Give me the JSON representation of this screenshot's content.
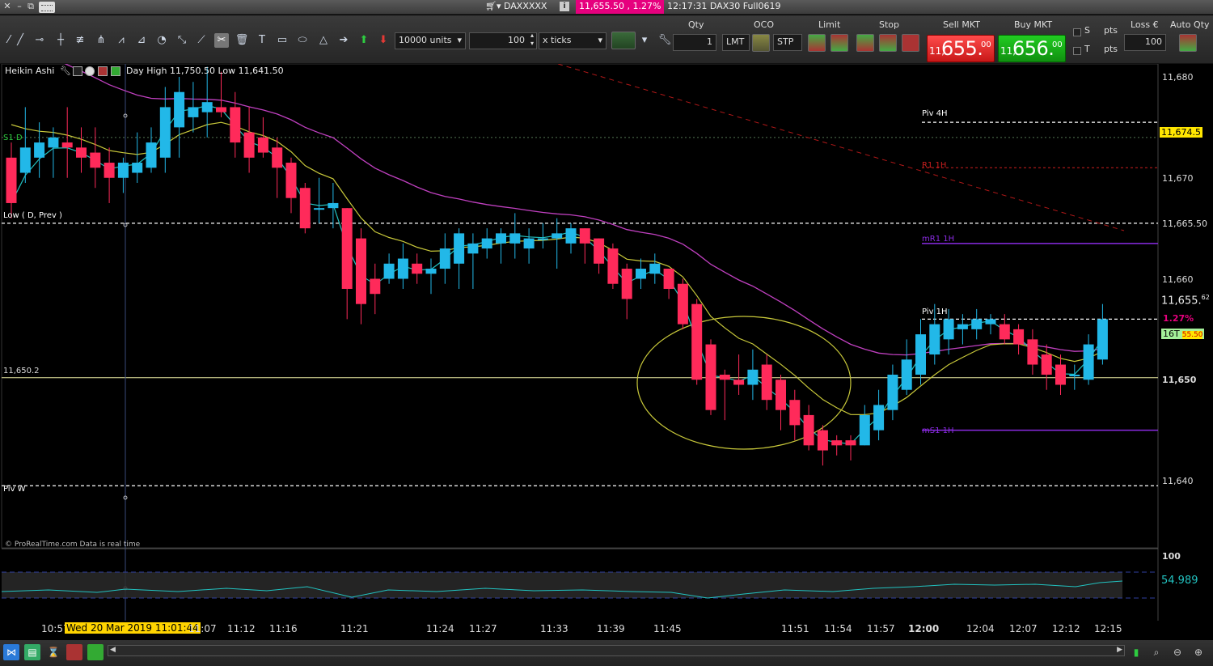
{
  "titlebar": {
    "instrument": "DAXXXXX",
    "price_change": "11,655.50 , 1.27%",
    "time_and_contract": "12:17:31 DAX30 Full0619"
  },
  "toolbar": {
    "units": "10000 units",
    "amount": "100",
    "mode": "x ticks",
    "qty_label": "Qty",
    "qty_value": "1",
    "oco_label": "OCO",
    "lmt": "LMT",
    "stp": "STP",
    "limit_label": "Limit",
    "stop_label": "Stop",
    "sell_label": "Sell MKT",
    "buy_label": "Buy MKT",
    "sell_price_small": "11,",
    "sell_price_big": "655.",
    "sell_price_sup": "00",
    "buy_price_small": "11,",
    "buy_price_big": "656.",
    "buy_price_sup": "00",
    "s_label": "S",
    "t_label": "T",
    "pts1": "pts",
    "pts2": "pts",
    "loss_label": "Loss €",
    "auto_qty_label": "Auto Qty",
    "loss_value": "100"
  },
  "chart": {
    "indicator_name": "Heikin Ashi",
    "day_hl": "Day High 11,750.50 Low 11,641.50",
    "y_labels": [
      "11,680",
      "11,670",
      "11,665.50",
      "11,660",
      "11,655",
      "11,650",
      "11,640"
    ],
    "price_tag_1": "11,674.5",
    "current_price": "11,655.",
    "current_sup": "62",
    "pct_tag": "1.27%",
    "timer_tag": "16T",
    "timer_price": "55.50",
    "level_line_value": "11,650.2",
    "labels": {
      "s1d": "S1 D",
      "low_d_prev": "Low ( D, Prev )",
      "piv_w": "Piv W",
      "piv_4h": "Piv 4H",
      "r1_1h": "R1 1H",
      "mr1_1h": "mR1 1H",
      "piv_1h": "Piv 1H",
      "ms1_1h": "mS1 1H"
    },
    "credit": "© ProRealTime.com  Data is real time",
    "osc_100": "100",
    "osc_value": "54.989"
  },
  "timeaxis": {
    "cursor_date": "Wed 20 Mar 2019 11:01:44",
    "ticks": [
      "10:57",
      "11:07",
      "11:12",
      "11:16",
      "11:21",
      "11:24",
      "11:27",
      "11:33",
      "11:39",
      "11:45",
      "11:51",
      "11:54",
      "11:57",
      "12:00",
      "12:04",
      "12:07",
      "12:12",
      "12:15"
    ]
  },
  "chart_data": {
    "type": "candlestick",
    "title": "",
    "ylim": [
      11637,
      11683
    ],
    "candles": [
      {
        "o": 11672.0,
        "h": 11673.5,
        "l": 11666.0,
        "c": 11667.5
      },
      {
        "o": 11670.5,
        "h": 11677.0,
        "l": 11669.5,
        "c": 11673.0
      },
      {
        "o": 11672.0,
        "h": 11675.5,
        "l": 11670.0,
        "c": 11673.5
      },
      {
        "o": 11673.0,
        "h": 11675.0,
        "l": 11670.0,
        "c": 11674.0
      },
      {
        "o": 11673.5,
        "h": 11677.0,
        "l": 11670.0,
        "c": 11673.0
      },
      {
        "o": 11673.0,
        "h": 11675.0,
        "l": 11670.5,
        "c": 11672.0
      },
      {
        "o": 11672.5,
        "h": 11675.0,
        "l": 11669.0,
        "c": 11671.0
      },
      {
        "o": 11671.5,
        "h": 11673.0,
        "l": 11667.5,
        "c": 11670.0
      },
      {
        "o": 11670.0,
        "h": 11672.0,
        "l": 11668.5,
        "c": 11671.5
      },
      {
        "o": 11670.5,
        "h": 11674.5,
        "l": 11669.5,
        "c": 11671.5
      },
      {
        "o": 11671.0,
        "h": 11675.0,
        "l": 11670.5,
        "c": 11673.5
      },
      {
        "o": 11672.0,
        "h": 11679.0,
        "l": 11670.5,
        "c": 11677.0
      },
      {
        "o": 11675.0,
        "h": 11680.0,
        "l": 11672.0,
        "c": 11678.5
      },
      {
        "o": 11676.0,
        "h": 11679.5,
        "l": 11674.5,
        "c": 11677.0
      },
      {
        "o": 11676.5,
        "h": 11681.0,
        "l": 11674.0,
        "c": 11677.5
      },
      {
        "o": 11677.0,
        "h": 11680.5,
        "l": 11676.0,
        "c": 11676.5
      },
      {
        "o": 11677.0,
        "h": 11678.5,
        "l": 11672.0,
        "c": 11673.5
      },
      {
        "o": 11674.5,
        "h": 11677.0,
        "l": 11670.5,
        "c": 11672.0
      },
      {
        "o": 11674.0,
        "h": 11676.0,
        "l": 11672.0,
        "c": 11672.5
      },
      {
        "o": 11673.0,
        "h": 11674.0,
        "l": 11668.0,
        "c": 11671.0
      },
      {
        "o": 11671.5,
        "h": 11672.0,
        "l": 11666.5,
        "c": 11668.0
      },
      {
        "o": 11669.0,
        "h": 11669.5,
        "l": 11664.5,
        "c": 11665.0
      },
      {
        "o": 11667.0,
        "h": 11670.0,
        "l": 11665.5,
        "c": 11667.0
      },
      {
        "o": 11667.0,
        "h": 11669.5,
        "l": 11665.0,
        "c": 11667.5
      },
      {
        "o": 11667.0,
        "h": 11667.0,
        "l": 11656.0,
        "c": 11659.0
      },
      {
        "o": 11664.0,
        "h": 11665.0,
        "l": 11655.5,
        "c": 11657.5
      },
      {
        "o": 11660.0,
        "h": 11661.5,
        "l": 11656.5,
        "c": 11658.5
      },
      {
        "o": 11660.0,
        "h": 11662.5,
        "l": 11659.5,
        "c": 11661.5
      },
      {
        "o": 11660.0,
        "h": 11663.5,
        "l": 11659.0,
        "c": 11662.0
      },
      {
        "o": 11661.5,
        "h": 11662.5,
        "l": 11659.5,
        "c": 11660.5
      },
      {
        "o": 11660.5,
        "h": 11662.0,
        "l": 11658.5,
        "c": 11661.0
      },
      {
        "o": 11661.0,
        "h": 11664.5,
        "l": 11659.5,
        "c": 11663.0
      },
      {
        "o": 11661.5,
        "h": 11665.0,
        "l": 11659.0,
        "c": 11664.5
      },
      {
        "o": 11662.5,
        "h": 11664.5,
        "l": 11659.0,
        "c": 11663.5
      },
      {
        "o": 11663.0,
        "h": 11665.0,
        "l": 11662.0,
        "c": 11664.0
      },
      {
        "o": 11663.5,
        "h": 11665.0,
        "l": 11661.5,
        "c": 11664.5
      },
      {
        "o": 11663.5,
        "h": 11666.5,
        "l": 11662.0,
        "c": 11664.5
      },
      {
        "o": 11663.0,
        "h": 11665.0,
        "l": 11661.5,
        "c": 11664.0
      },
      {
        "o": 11664.0,
        "h": 11665.5,
        "l": 11663.0,
        "c": 11664.0
      },
      {
        "o": 11664.0,
        "h": 11666.0,
        "l": 11661.0,
        "c": 11664.5
      },
      {
        "o": 11663.5,
        "h": 11665.5,
        "l": 11662.5,
        "c": 11665.0
      },
      {
        "o": 11665.0,
        "h": 11665.0,
        "l": 11661.5,
        "c": 11663.5
      },
      {
        "o": 11664.0,
        "h": 11664.0,
        "l": 11660.5,
        "c": 11661.5
      },
      {
        "o": 11663.0,
        "h": 11663.5,
        "l": 11659.0,
        "c": 11659.5
      },
      {
        "o": 11661.0,
        "h": 11661.5,
        "l": 11656.0,
        "c": 11658.0
      },
      {
        "o": 11660.0,
        "h": 11662.0,
        "l": 11659.0,
        "c": 11661.0
      },
      {
        "o": 11660.5,
        "h": 11662.5,
        "l": 11659.5,
        "c": 11661.5
      },
      {
        "o": 11661.0,
        "h": 11661.0,
        "l": 11658.0,
        "c": 11659.0
      },
      {
        "o": 11659.5,
        "h": 11660.0,
        "l": 11655.0,
        "c": 11655.5
      },
      {
        "o": 11657.5,
        "h": 11658.0,
        "l": 11649.5,
        "c": 11650.0
      },
      {
        "o": 11653.5,
        "h": 11654.0,
        "l": 11646.5,
        "c": 11647.0
      },
      {
        "o": 11650.5,
        "h": 11651.0,
        "l": 11646.0,
        "c": 11650.0
      },
      {
        "o": 11650.0,
        "h": 11652.5,
        "l": 11648.5,
        "c": 11649.5
      },
      {
        "o": 11649.5,
        "h": 11653.0,
        "l": 11648.0,
        "c": 11651.0
      },
      {
        "o": 11651.5,
        "h": 11652.5,
        "l": 11647.0,
        "c": 11648.0
      },
      {
        "o": 11650.0,
        "h": 11650.5,
        "l": 11645.0,
        "c": 11647.0
      },
      {
        "o": 11648.0,
        "h": 11649.0,
        "l": 11644.0,
        "c": 11645.5
      },
      {
        "o": 11646.5,
        "h": 11647.5,
        "l": 11643.0,
        "c": 11643.5
      },
      {
        "o": 11645.0,
        "h": 11645.5,
        "l": 11641.5,
        "c": 11643.0
      },
      {
        "o": 11644.0,
        "h": 11644.5,
        "l": 11642.5,
        "c": 11643.5
      },
      {
        "o": 11644.0,
        "h": 11644.5,
        "l": 11642.0,
        "c": 11643.5
      },
      {
        "o": 11643.5,
        "h": 11647.5,
        "l": 11643.5,
        "c": 11646.5
      },
      {
        "o": 11645.0,
        "h": 11649.0,
        "l": 11644.0,
        "c": 11647.5
      },
      {
        "o": 11647.0,
        "h": 11651.5,
        "l": 11646.0,
        "c": 11650.5
      },
      {
        "o": 11649.0,
        "h": 11654.0,
        "l": 11648.5,
        "c": 11652.0
      },
      {
        "o": 11650.5,
        "h": 11656.0,
        "l": 11649.5,
        "c": 11654.5
      },
      {
        "o": 11652.5,
        "h": 11657.5,
        "l": 11651.5,
        "c": 11655.5
      },
      {
        "o": 11654.0,
        "h": 11657.0,
        "l": 11652.5,
        "c": 11656.0
      },
      {
        "o": 11655.0,
        "h": 11656.5,
        "l": 11653.5,
        "c": 11655.5
      },
      {
        "o": 11655.0,
        "h": 11657.0,
        "l": 11654.0,
        "c": 11656.0
      },
      {
        "o": 11655.5,
        "h": 11656.5,
        "l": 11654.5,
        "c": 11656.0
      },
      {
        "o": 11655.5,
        "h": 11656.5,
        "l": 11653.5,
        "c": 11654.0
      },
      {
        "o": 11655.0,
        "h": 11655.5,
        "l": 11652.5,
        "c": 11653.5
      },
      {
        "o": 11654.0,
        "h": 11655.0,
        "l": 11650.5,
        "c": 11651.5
      },
      {
        "o": 11652.5,
        "h": 11653.5,
        "l": 11649.0,
        "c": 11650.5
      },
      {
        "o": 11651.5,
        "h": 11652.5,
        "l": 11648.5,
        "c": 11649.5
      },
      {
        "o": 11650.5,
        "h": 11651.5,
        "l": 11649.0,
        "c": 11650.5
      },
      {
        "o": 11650.0,
        "h": 11654.5,
        "l": 11649.5,
        "c": 11653.5
      },
      {
        "o": 11652.0,
        "h": 11657.5,
        "l": 11651.5,
        "c": 11656.0
      }
    ],
    "levels": {
      "piv_4h": 11675.5,
      "dotted_guide": 11674.0,
      "r1_1h": 11671.0,
      "low_d_prev": 11665.5,
      "mr1_1h": 11663.5,
      "piv_1h": 11656.0,
      "level_line": 11650.2,
      "ms1_1h": 11645.0,
      "piv_w": 11639.5
    },
    "colors": {
      "bull": "#22b8e8",
      "bear": "#ff2a5a",
      "ma_fast": "#22c2c0",
      "ma_mid": "#c8c83a",
      "ma_slow": "#c040c0",
      "r1": "#cc1f1f",
      "mr1": "#8a2be2",
      "level_line": "#e8e8a0",
      "pct_tag": "#e6007e",
      "price_tag": "#ffe600"
    }
  }
}
